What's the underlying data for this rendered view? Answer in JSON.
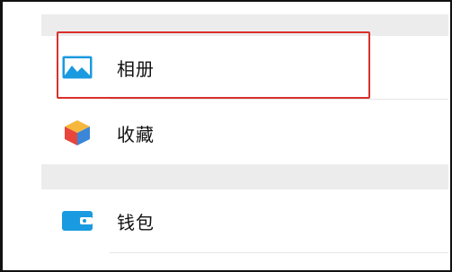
{
  "menu": {
    "items": [
      {
        "label": "相册",
        "icon": "photo-album-icon"
      },
      {
        "label": "收藏",
        "icon": "favorites-cube-icon"
      },
      {
        "label": "钱包",
        "icon": "wallet-icon"
      }
    ]
  },
  "colors": {
    "highlight": "#d9302c",
    "icon_blue": "#1a9ae0",
    "cube_red": "#e8453c",
    "cube_yellow": "#f6b73c",
    "cube_blue": "#3b86d8",
    "section_gap": "#ececec"
  }
}
